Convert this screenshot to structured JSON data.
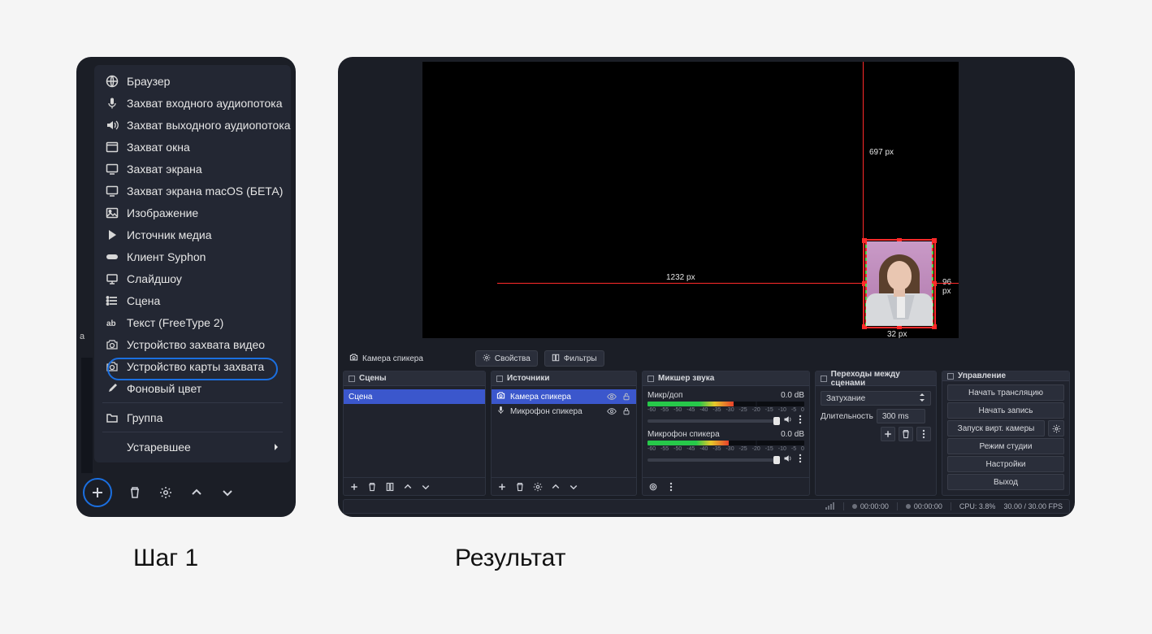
{
  "captions": {
    "left": "Шаг 1",
    "right": "Результат"
  },
  "menu": {
    "items": [
      {
        "icon": "globe-icon",
        "label": "Браузер"
      },
      {
        "icon": "mic-icon",
        "label": "Захват входного аудиопотока"
      },
      {
        "icon": "speaker-icon",
        "label": "Захват выходного аудиопотока"
      },
      {
        "icon": "window-icon",
        "label": "Захват окна"
      },
      {
        "icon": "display-icon",
        "label": "Захват экрана"
      },
      {
        "icon": "display-icon",
        "label": "Захват экрана macOS (БЕТА)"
      },
      {
        "icon": "image-icon",
        "label": "Изображение"
      },
      {
        "icon": "play-icon",
        "label": "Источник медиа"
      },
      {
        "icon": "gamepad-icon",
        "label": "Клиент Syphon"
      },
      {
        "icon": "slideshow-icon",
        "label": "Слайдшоу"
      },
      {
        "icon": "list-icon",
        "label": "Сцена"
      },
      {
        "icon": "text-icon",
        "label": "Текст (FreeType 2)"
      },
      {
        "icon": "camera-icon",
        "label": "Устройство захвата видео",
        "highlighted": true
      },
      {
        "icon": "camera-icon",
        "label": "Устройство карты захвата"
      },
      {
        "icon": "brush-icon",
        "label": "Фоновый цвет"
      }
    ],
    "group": {
      "icon": "folder-icon",
      "label": "Группа"
    },
    "deprecated": "Устаревшее"
  },
  "left_bg_hint": "а",
  "toolbar": {
    "source_name": "Камера спикера",
    "properties": "Свойства",
    "filters": "Фильтры"
  },
  "guides": {
    "top": "697 px",
    "left": "1232 px",
    "right": "96 px",
    "bottom": "32 px"
  },
  "panels": {
    "scenes": {
      "title": "Сцены",
      "item": "Сцена"
    },
    "sources": {
      "title": "Источники",
      "items": [
        {
          "icon": "camera-icon",
          "label": "Камера спикера",
          "selected": true
        },
        {
          "icon": "mic-icon",
          "label": "Микрофон спикера"
        }
      ]
    },
    "mixer": {
      "title": "Микшер звука",
      "channels": [
        {
          "name": "Микр/доп",
          "db": "0.0 dB"
        },
        {
          "name": "Микрофон спикера",
          "db": "0.0 dB"
        }
      ],
      "ticks": [
        "-60",
        "-55",
        "-50",
        "-45",
        "-40",
        "-35",
        "-30",
        "-25",
        "-20",
        "-15",
        "-10",
        "-5",
        "0"
      ]
    },
    "transitions": {
      "title": "Переходы между сценами",
      "type": "Затухание",
      "duration_label": "Длительность",
      "duration_value": "300 ms"
    },
    "controls": {
      "title": "Управление",
      "buttons": {
        "start_stream": "Начать трансляцию",
        "start_record": "Начать запись",
        "start_vcam": "Запуск вирт. камеры",
        "studio": "Режим студии",
        "settings": "Настройки",
        "exit": "Выход"
      }
    }
  },
  "status": {
    "t1": "00:00:00",
    "t2": "00:00:00",
    "cpu": "CPU: 3.8%",
    "fps": "30.00 / 30.00 FPS"
  }
}
